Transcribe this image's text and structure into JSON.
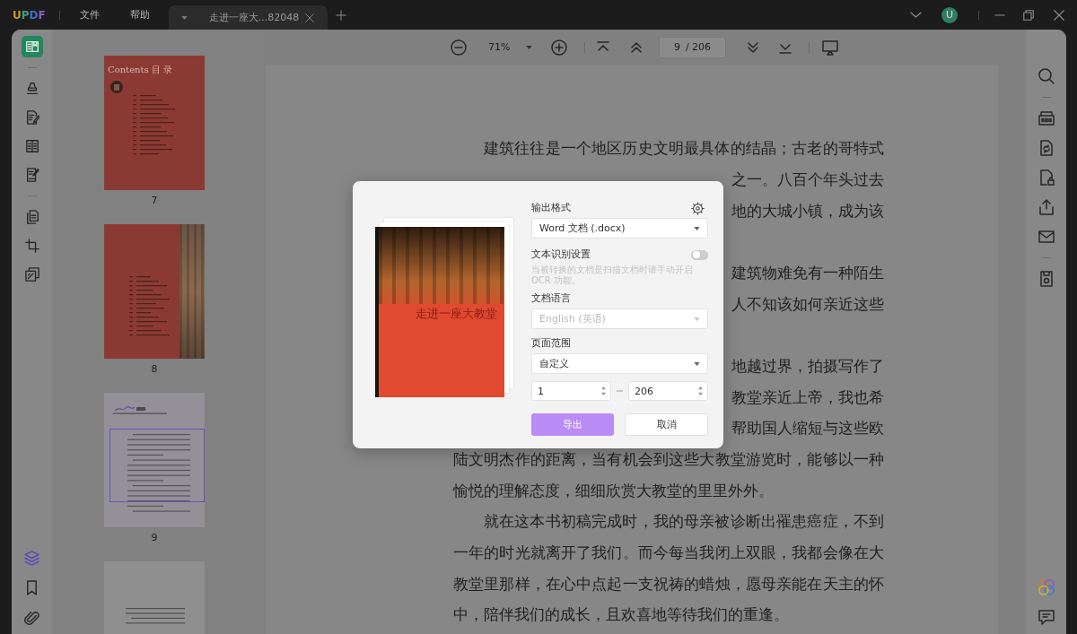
{
  "title_bar": {
    "logo": "UPDF",
    "menus": [
      {
        "label": "文件"
      },
      {
        "label": "帮助"
      }
    ],
    "tabs": [
      {
        "title": "走进一座大...82048",
        "selected": true
      }
    ],
    "avatar": {
      "initial": "U"
    }
  },
  "left_rail": {
    "tool_groups": [
      {
        "tools": [
          {
            "selected": true
          }
        ]
      },
      {
        "tools": [
          {
            "selected": false
          },
          {
            "selected": false
          },
          {
            "selected": false
          },
          {
            "selected": false
          }
        ]
      },
      {
        "tools": [
          {
            "selected": false
          },
          {
            "selected": false
          },
          {
            "selected": false
          }
        ]
      }
    ],
    "panel_buttons": [
      {
        "selected": true
      },
      {
        "selected": false
      },
      {
        "selected": false
      }
    ]
  },
  "thumbnails": [
    {
      "kind": "contents",
      "heading": "Contents 目 录",
      "label": "7",
      "selected": false
    },
    {
      "kind": "contents_photo",
      "label": "8",
      "selected": false
    },
    {
      "kind": "preface",
      "label": "9",
      "selected": true
    },
    {
      "kind": "text",
      "selected": false
    }
  ],
  "toolbar": {
    "zoom": "71%",
    "page": {
      "value": "9",
      "total": "/ 206"
    }
  },
  "document": {
    "lines": [
      {
        "kind": "first",
        "text": "建筑往往是一个地区历史文明最具体的结晶；古老的哥特式"
      },
      {
        "kind": "fragment",
        "text": "之一。八百个年头过去"
      },
      {
        "kind": "fragment",
        "text": "地的大城小镇，成为该"
      },
      {
        "kind": "covered"
      },
      {
        "kind": "fragment",
        "text": "建筑物难免有一种陌生"
      },
      {
        "kind": "fragment",
        "text": "人不知该如何亲近这些"
      },
      {
        "kind": "covered"
      },
      {
        "kind": "fragment",
        "text": "地越过界，拍摄写作了"
      },
      {
        "kind": "fragment",
        "text": "教堂亲近上帝，我也希"
      },
      {
        "kind": "fragment",
        "text": "帮助国人缩短与这些欧"
      },
      {
        "kind": "line",
        "text": "陆文明杰作的距离，当有机会到这些大教堂游览时，能够以一种"
      },
      {
        "kind": "last",
        "text": "愉悦的理解态度，细细欣赏大教堂的里里外外。"
      },
      {
        "kind": "first",
        "text": "就在这本书初稿完成时，我的母亲被诊断出罹患癌症，不到"
      },
      {
        "kind": "line",
        "text": "一年的时光就离开了我们。而今每当我闭上双眼，我都会像在大"
      },
      {
        "kind": "line",
        "text": "教堂里那样，在心中点起一支祝祷的蜡烛，愿母亲能在天主的怀"
      },
      {
        "kind": "last",
        "text": "中，陪伴我们的成长，且欢喜地等待我们的重逢。"
      }
    ]
  },
  "export_dialog": {
    "preview": {
      "title": "走进一座大教堂"
    },
    "fields": [
      {
        "kind": "select",
        "label": "输出格式",
        "value": "Word 文档 (.docx)",
        "disabled": false
      },
      {
        "kind": "toggle",
        "label": "文本识别设置",
        "on": false,
        "hint": "当被转换的文档是扫描文档时请手动开启 OCR 功能。"
      },
      {
        "kind": "select",
        "label": "文档语言",
        "value": "English (英语)",
        "disabled": true
      },
      {
        "kind": "select",
        "label": "页面范围",
        "value": "自定义",
        "disabled": false
      },
      {
        "kind": "range",
        "from": "1",
        "to": "206"
      }
    ],
    "buttons": [
      {
        "kind": "primary",
        "label": "导出"
      },
      {
        "kind": "secondary",
        "label": "取消"
      }
    ]
  }
}
